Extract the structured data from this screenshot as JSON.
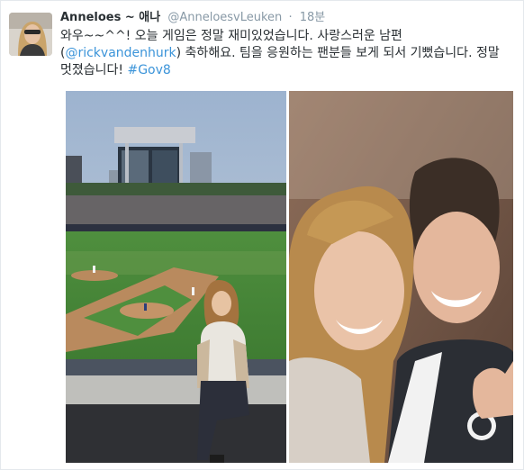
{
  "tweet": {
    "display_name": "Anneloes ~ 애나",
    "handle": "@AnneloesvLeuken",
    "separator": "·",
    "time": "18분",
    "text_line1": "와우~~^^! 오늘 게임은 정말 재미있었습니다. 사랑스러운 남편",
    "mention": "@rickvandenhurk",
    "text_line2_open": "(",
    "text_line2_after": ") 축하해요. 팀을 응원하는 팬분들 보게 되서 기뻤습니다. 정말",
    "text_line3": "멋졌습니다!",
    "hashtag": "#Gov8"
  }
}
